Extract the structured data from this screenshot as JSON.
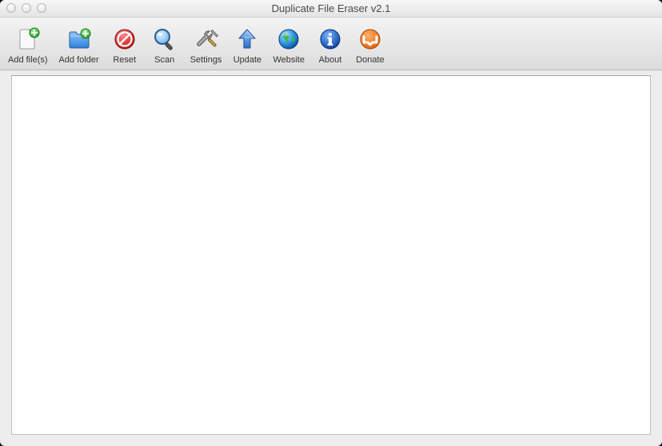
{
  "window": {
    "title": "Duplicate File Eraser v2.1"
  },
  "toolbar": {
    "add_files": "Add file(s)",
    "add_folder": "Add folder",
    "reset": "Reset",
    "scan": "Scan",
    "settings": "Settings",
    "update": "Update",
    "website": "Website",
    "about": "About",
    "donate": "Donate"
  }
}
